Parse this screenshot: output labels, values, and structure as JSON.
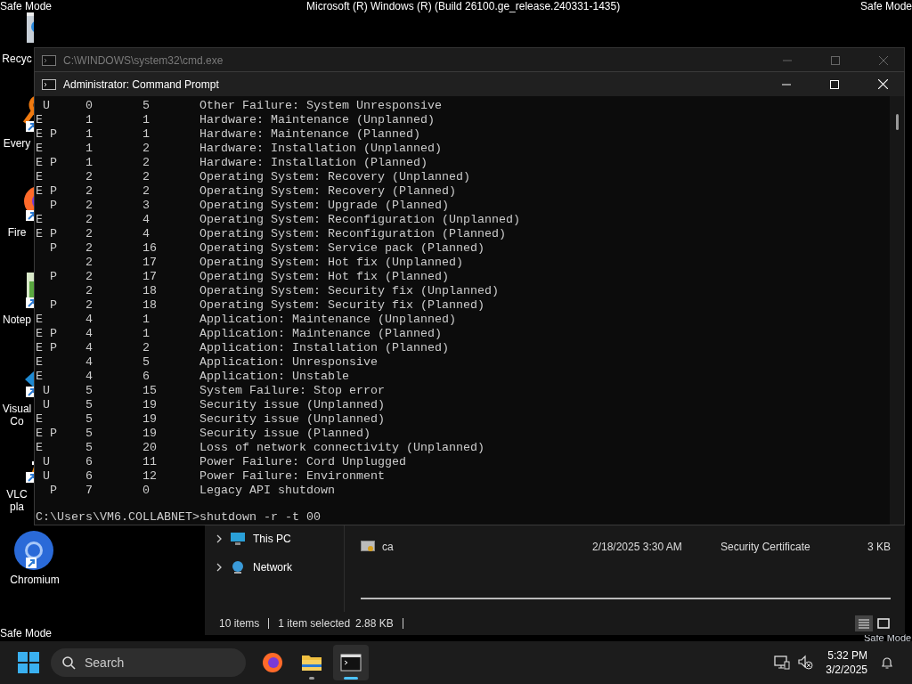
{
  "desktop": {
    "top_left_label": "Safe Mode",
    "build_label": "Microsoft (R) Windows (R) (Build 26100.ge_release.240331-1435)",
    "top_right_label": "Safe Mode",
    "bottom_left_label": "Safe Mode",
    "bottom_right_label": "Safe Mode",
    "icons": [
      {
        "kind": "recycle",
        "label_lines": [
          "Recyc"
        ]
      },
      {
        "kind": "everything",
        "label_lines": [
          "Every"
        ]
      },
      {
        "kind": "firefox",
        "label_lines": [
          "Fire"
        ]
      },
      {
        "kind": "notepad",
        "label_lines": [
          "Notep"
        ]
      },
      {
        "kind": "vscode",
        "label_lines": [
          "Visual",
          "Co"
        ]
      },
      {
        "kind": "vlc",
        "label_lines": [
          "VLC",
          "pla"
        ]
      },
      {
        "kind": "chromium",
        "label_lines": [
          "Chromium"
        ]
      }
    ]
  },
  "background_window": {
    "title": "C:\\WINDOWS\\system32\\cmd.exe"
  },
  "command_prompt": {
    "title": "Administrator: Command Prompt",
    "lines": [
      " U     0       5       Other Failure: System Unresponsive",
      "E      1       1       Hardware: Maintenance (Unplanned)",
      "E P    1       1       Hardware: Maintenance (Planned)",
      "E      1       2       Hardware: Installation (Unplanned)",
      "E P    1       2       Hardware: Installation (Planned)",
      "E      2       2       Operating System: Recovery (Unplanned)",
      "E P    2       2       Operating System: Recovery (Planned)",
      "  P    2       3       Operating System: Upgrade (Planned)",
      "E      2       4       Operating System: Reconfiguration (Unplanned)",
      "E P    2       4       Operating System: Reconfiguration (Planned)",
      "  P    2       16      Operating System: Service pack (Planned)",
      "       2       17      Operating System: Hot fix (Unplanned)",
      "  P    2       17      Operating System: Hot fix (Planned)",
      "       2       18      Operating System: Security fix (Unplanned)",
      "  P    2       18      Operating System: Security fix (Planned)",
      "E      4       1       Application: Maintenance (Unplanned)",
      "E P    4       1       Application: Maintenance (Planned)",
      "E P    4       2       Application: Installation (Planned)",
      "E      4       5       Application: Unresponsive",
      "E      4       6       Application: Unstable",
      " U     5       15      System Failure: Stop error",
      " U     5       19      Security issue (Unplanned)",
      "E      5       19      Security issue (Unplanned)",
      "E P    5       19      Security issue (Planned)",
      "E      5       20      Loss of network connectivity (Unplanned)",
      " U     6       11      Power Failure: Cord Unplugged",
      " U     6       12      Power Failure: Environment",
      "  P    7       0       Legacy API shutdown"
    ],
    "prompt": "C:\\Users\\VM6.COLLABNET>shutdown -r -t 00"
  },
  "file_explorer": {
    "nav_items": [
      {
        "label": "This PC",
        "kind": "pc"
      },
      {
        "label": "Network",
        "kind": "network"
      }
    ],
    "files": [
      {
        "name": "ca",
        "date_modified": "2/18/2025 3:30 AM",
        "type": "Security Certificate",
        "size": "3 KB"
      }
    ],
    "status": {
      "item_count": "10 items",
      "selection": "1 item selected",
      "size": "2.88 KB"
    }
  },
  "taskbar": {
    "search_placeholder": "Search",
    "apps": [
      {
        "kind": "firefox",
        "running": false,
        "active": false
      },
      {
        "kind": "folder",
        "running": true,
        "active": false
      },
      {
        "kind": "terminal",
        "running": true,
        "active": true
      }
    ],
    "time": "5:32 PM",
    "date": "3/2/2025"
  }
}
